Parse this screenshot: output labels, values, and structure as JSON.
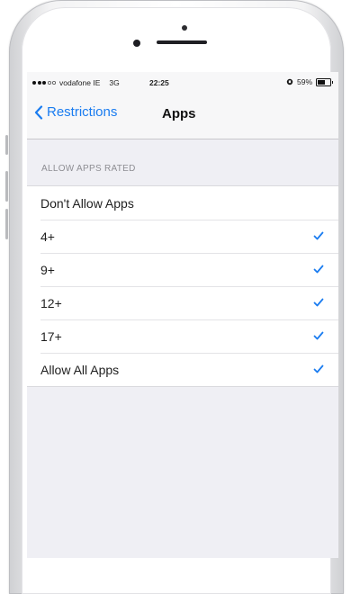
{
  "status_bar": {
    "signal_dots_filled": 3,
    "signal_dots_total": 5,
    "carrier": "vodafone IE",
    "network": "3G",
    "time": "22:25",
    "battery_text": "59%",
    "battery_level": 0.59
  },
  "nav": {
    "back_label": "Restrictions",
    "title": "Apps"
  },
  "section": {
    "header": "ALLOW APPS RATED"
  },
  "options": [
    {
      "label": "Don't Allow Apps",
      "checked": false
    },
    {
      "label": "4+",
      "checked": true
    },
    {
      "label": "9+",
      "checked": true
    },
    {
      "label": "12+",
      "checked": true
    },
    {
      "label": "17+",
      "checked": true
    },
    {
      "label": "Allow All Apps",
      "checked": true
    }
  ],
  "colors": {
    "accent": "#1a7cf0",
    "background": "#efeff4"
  }
}
